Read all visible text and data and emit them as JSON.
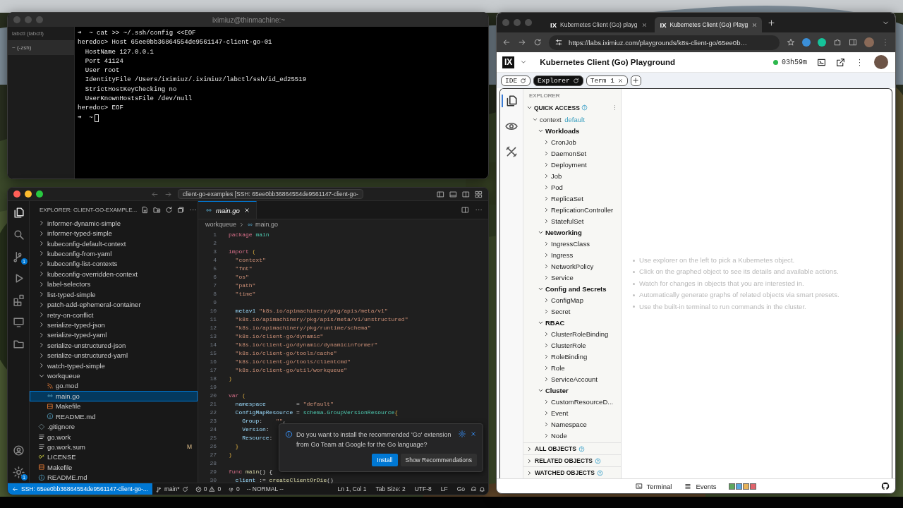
{
  "terminal": {
    "title": "iximiuz@thinmachine:~",
    "sessions": [
      {
        "label": "labctl (labctl)",
        "selected": false
      },
      {
        "label": "~ (-zsh)",
        "selected": true
      }
    ],
    "lines": [
      "➜  ~ cat >> ~/.ssh/config <<EOF",
      "heredoc> Host 65ee0bb36864554de9561147-client-go-01",
      "  HostName 127.0.0.1",
      "  Port 41124",
      "  User root",
      "  IdentityFile /Users/iximiuz/.iximiuz/labctl/ssh/id_ed25519",
      "  StrictHostKeyChecking no",
      "  UserKnownHostsFile /dev/null",
      "heredoc> EOF"
    ],
    "prompt": "➜  ~"
  },
  "vscode": {
    "command_center": "client-go-examples [SSH: 65ee0bb36864554de9561147-client-go-",
    "activity_bar": [
      {
        "kind": "explorer",
        "selected": true
      },
      {
        "kind": "search",
        "selected": false
      },
      {
        "kind": "scm",
        "selected": false,
        "badge": "1"
      },
      {
        "kind": "debug",
        "selected": false
      },
      {
        "kind": "extensions",
        "selected": false
      },
      {
        "kind": "remote",
        "selected": false
      },
      {
        "kind": "folder",
        "selected": false
      }
    ],
    "activity_bottom": [
      {
        "kind": "account",
        "selected": false
      },
      {
        "kind": "settings",
        "selected": false,
        "badge": "1"
      }
    ],
    "explorer_title": "EXPLORER: CLIENT-GO-EXAMPLE...",
    "files": [
      {
        "name": "informer-dynamic-simple",
        "kind": "folder",
        "expanded": false,
        "selected": false
      },
      {
        "name": "informer-typed-simple",
        "kind": "folder",
        "expanded": false,
        "selected": false
      },
      {
        "name": "kubeconfig-default-context",
        "kind": "folder",
        "expanded": false,
        "selected": false
      },
      {
        "name": "kubeconfig-from-yaml",
        "kind": "folder",
        "expanded": false,
        "selected": false
      },
      {
        "name": "kubeconfig-list-contexts",
        "kind": "folder",
        "expanded": false,
        "selected": false
      },
      {
        "name": "kubeconfig-overridden-context",
        "kind": "folder",
        "expanded": false,
        "selected": false
      },
      {
        "name": "label-selectors",
        "kind": "folder",
        "expanded": false,
        "selected": false
      },
      {
        "name": "list-typed-simple",
        "kind": "folder",
        "expanded": false,
        "selected": false
      },
      {
        "name": "patch-add-ephemeral-container",
        "kind": "folder",
        "expanded": false,
        "selected": false
      },
      {
        "name": "retry-on-conflict",
        "kind": "folder",
        "expanded": false,
        "selected": false
      },
      {
        "name": "serialize-typed-json",
        "kind": "folder",
        "expanded": false,
        "selected": false
      },
      {
        "name": "serialize-typed-yaml",
        "kind": "folder",
        "expanded": false,
        "selected": false
      },
      {
        "name": "serialize-unstructured-json",
        "kind": "folder",
        "expanded": false,
        "selected": false
      },
      {
        "name": "serialize-unstructured-yaml",
        "kind": "folder",
        "expanded": false,
        "selected": false
      },
      {
        "name": "watch-typed-simple",
        "kind": "folder",
        "expanded": false,
        "selected": false
      },
      {
        "name": "workqueue",
        "kind": "folder",
        "expanded": true,
        "selected": false,
        "children": [
          {
            "name": "go.mod",
            "kind": "gomod",
            "selected": false
          },
          {
            "name": "main.go",
            "kind": "go",
            "selected": true
          },
          {
            "name": "Makefile",
            "kind": "make",
            "selected": false
          },
          {
            "name": "README.md",
            "kind": "readme",
            "selected": false
          }
        ]
      },
      {
        "name": ".gitignore",
        "kind": "git",
        "selected": false
      },
      {
        "name": "go.work",
        "kind": "text",
        "selected": false
      },
      {
        "name": "go.work.sum",
        "kind": "text",
        "selected": false,
        "badge": "M"
      },
      {
        "name": "LICENSE",
        "kind": "license",
        "selected": false
      },
      {
        "name": "Makefile",
        "kind": "make",
        "selected": false
      },
      {
        "name": "README.md",
        "kind": "readme",
        "selected": false
      }
    ],
    "tab": {
      "label": "main.go"
    },
    "breadcrumb": [
      "workqueue",
      "main.go"
    ],
    "code": [
      {
        "number": "1",
        "tokens": [
          {
            "kind": "kw",
            "text": "package "
          },
          {
            "kind": "type",
            "text": "main"
          }
        ]
      },
      {
        "number": "2"
      },
      {
        "number": "3",
        "tokens": [
          {
            "kind": "kw",
            "text": "import "
          },
          {
            "kind": "punc",
            "text": "("
          }
        ]
      },
      {
        "number": "4",
        "tokens": [
          {
            "kind": "str",
            "text": "  \"context\""
          }
        ]
      },
      {
        "number": "5",
        "tokens": [
          {
            "kind": "str",
            "text": "  \"fmt\""
          }
        ]
      },
      {
        "number": "6",
        "tokens": [
          {
            "kind": "str",
            "text": "  \"os\""
          }
        ]
      },
      {
        "number": "7",
        "tokens": [
          {
            "kind": "str",
            "text": "  \"path\""
          }
        ]
      },
      {
        "number": "8",
        "tokens": [
          {
            "kind": "str",
            "text": "  \"time\""
          }
        ]
      },
      {
        "number": "9"
      },
      {
        "number": "10",
        "tokens": [
          {
            "kind": "var",
            "text": "  metav1 "
          },
          {
            "kind": "str",
            "text": "\"k8s.io/apimachinery/pkg/apis/meta/v1\""
          }
        ]
      },
      {
        "number": "11",
        "tokens": [
          {
            "kind": "str",
            "text": "  \"k8s.io/apimachinery/pkg/apis/meta/v1/unstructured\""
          }
        ]
      },
      {
        "number": "12",
        "tokens": [
          {
            "kind": "str",
            "text": "  \"k8s.io/apimachinery/pkg/runtime/schema\""
          }
        ]
      },
      {
        "number": "13",
        "tokens": [
          {
            "kind": "str",
            "text": "  \"k8s.io/client-go/dynamic\""
          }
        ]
      },
      {
        "number": "14",
        "tokens": [
          {
            "kind": "str",
            "text": "  \"k8s.io/client-go/dynamic/dynamicinformer\""
          }
        ]
      },
      {
        "number": "15",
        "tokens": [
          {
            "kind": "str",
            "text": "  \"k8s.io/client-go/tools/cache\""
          }
        ]
      },
      {
        "number": "16",
        "tokens": [
          {
            "kind": "str",
            "text": "  \"k8s.io/client-go/tools/clientcmd\""
          }
        ]
      },
      {
        "number": "17",
        "tokens": [
          {
            "kind": "str",
            "text": "  \"k8s.io/client-go/util/workqueue\""
          }
        ]
      },
      {
        "number": "18",
        "tokens": [
          {
            "kind": "punc",
            "text": ")"
          }
        ]
      },
      {
        "number": "19"
      },
      {
        "number": "20",
        "tokens": [
          {
            "kind": "kw",
            "text": "var "
          },
          {
            "kind": "punc",
            "text": "("
          }
        ]
      },
      {
        "number": "21",
        "tokens": [
          {
            "kind": "var",
            "text": "  namespace"
          },
          {
            "kind": "plain",
            "text": "         = "
          },
          {
            "kind": "str",
            "text": "\"default\""
          }
        ]
      },
      {
        "number": "22",
        "tokens": [
          {
            "kind": "var",
            "text": "  ConfigMapResource"
          },
          {
            "kind": "plain",
            "text": " = "
          },
          {
            "kind": "type",
            "text": "schema"
          },
          {
            "kind": "plain",
            "text": "."
          },
          {
            "kind": "type",
            "text": "GroupVersionResource"
          },
          {
            "kind": "punc",
            "text": "{"
          }
        ]
      },
      {
        "number": "23",
        "tokens": [
          {
            "kind": "var",
            "text": "    Group"
          },
          {
            "kind": "plain",
            "text": ":    "
          },
          {
            "kind": "str",
            "text": "\"\""
          },
          {
            "kind": "plain",
            "text": ","
          }
        ]
      },
      {
        "number": "24",
        "tokens": [
          {
            "kind": "var",
            "text": "    Version"
          },
          {
            "kind": "plain",
            "text": ":"
          }
        ]
      },
      {
        "number": "25",
        "tokens": [
          {
            "kind": "var",
            "text": "    Resource"
          },
          {
            "kind": "plain",
            "text": ":"
          }
        ]
      },
      {
        "number": "26",
        "tokens": [
          {
            "kind": "punc",
            "text": "  }"
          }
        ]
      },
      {
        "number": "27",
        "tokens": [
          {
            "kind": "punc",
            "text": ")"
          }
        ]
      },
      {
        "number": "28"
      },
      {
        "number": "29",
        "tokens": [
          {
            "kind": "kw",
            "text": "func "
          },
          {
            "kind": "fn",
            "text": "main"
          },
          {
            "kind": "plain",
            "text": "() {"
          }
        ]
      },
      {
        "number": "30",
        "tokens": [
          {
            "kind": "var",
            "text": "  client"
          },
          {
            "kind": "plain",
            "text": " := "
          },
          {
            "kind": "fn",
            "text": "createClientOrDie"
          },
          {
            "kind": "plain",
            "text": "()"
          }
        ]
      }
    ],
    "notification": {
      "message": "Do you want to install the recommended 'Go' extension from Go Team at Google for the Go language?",
      "buttons": [
        {
          "label": "Install",
          "kind": "primary"
        },
        {
          "label": "Show Recommendations",
          "kind": "secondary"
        }
      ]
    },
    "status_bar": {
      "remote": "SSH: 65ee0bb36864554de9561147-client-go-...",
      "branch": "main*",
      "errors": "0",
      "warnings": "0",
      "ports": "0",
      "mode": "-- NORMAL --",
      "items": [
        "Ln 1, Col 1",
        "Tab Size: 2",
        "UTF-8",
        "LF",
        "Go"
      ]
    }
  },
  "browser": {
    "tabs": [
      {
        "logo": "IX",
        "title": "Kubernetes Client (Go) playg",
        "selected": false
      },
      {
        "logo": "IX",
        "title": "Kubernetes Client (Go) Playg",
        "selected": true
      }
    ],
    "url": "https://labs.iximiuz.com/playgrounds/k8s-client-go/65ee0b…",
    "page": {
      "logo": "IX",
      "title": "Kubernetes Client (Go) Playground",
      "timer": "03h59m",
      "tabs": [
        {
          "label": "IDE",
          "kind": "view",
          "selected": false
        },
        {
          "label": "Explorer",
          "kind": "view",
          "selected": true
        },
        {
          "label": "Term 1",
          "kind": "terminal",
          "selected": false
        }
      ],
      "rail": [
        {
          "kind": "files",
          "selected": true
        },
        {
          "kind": "watch",
          "selected": false
        },
        {
          "kind": "tools",
          "selected": false
        }
      ],
      "explorer": {
        "heading": "EXPLORER",
        "quick_access": "QUICK ACCESS",
        "tree": [
          {
            "label": "context",
            "value": "default",
            "kind": "context",
            "expanded": true,
            "children": [
              {
                "label": "Workloads",
                "kind": "group",
                "expanded": true,
                "children": [
                  {
                    "label": "CronJob",
                    "kind": "resource",
                    "expanded": false
                  },
                  {
                    "label": "DaemonSet",
                    "kind": "resource",
                    "expanded": false
                  },
                  {
                    "label": "Deployment",
                    "kind": "resource",
                    "expanded": false
                  },
                  {
                    "label": "Job",
                    "kind": "resource",
                    "expanded": false
                  },
                  {
                    "label": "Pod",
                    "kind": "resource",
                    "expanded": false
                  },
                  {
                    "label": "ReplicaSet",
                    "kind": "resource",
                    "expanded": false
                  },
                  {
                    "label": "ReplicationController",
                    "kind": "resource",
                    "expanded": false
                  },
                  {
                    "label": "StatefulSet",
                    "kind": "resource",
                    "expanded": false
                  }
                ]
              },
              {
                "label": "Networking",
                "kind": "group",
                "expanded": true,
                "children": [
                  {
                    "label": "IngressClass",
                    "kind": "resource",
                    "expanded": false
                  },
                  {
                    "label": "Ingress",
                    "kind": "resource",
                    "expanded": false
                  },
                  {
                    "label": "NetworkPolicy",
                    "kind": "resource",
                    "expanded": false
                  },
                  {
                    "label": "Service",
                    "kind": "resource",
                    "expanded": false
                  }
                ]
              },
              {
                "label": "Config and Secrets",
                "kind": "group",
                "expanded": true,
                "children": [
                  {
                    "label": "ConfigMap",
                    "kind": "resource",
                    "expanded": false
                  },
                  {
                    "label": "Secret",
                    "kind": "resource",
                    "expanded": false
                  }
                ]
              },
              {
                "label": "RBAC",
                "kind": "group",
                "expanded": true,
                "children": [
                  {
                    "label": "ClusterRoleBinding",
                    "kind": "resource",
                    "expanded": false
                  },
                  {
                    "label": "ClusterRole",
                    "kind": "resource",
                    "expanded": false
                  },
                  {
                    "label": "RoleBinding",
                    "kind": "resource",
                    "expanded": false
                  },
                  {
                    "label": "Role",
                    "kind": "resource",
                    "expanded": false
                  },
                  {
                    "label": "ServiceAccount",
                    "kind": "resource",
                    "expanded": false
                  }
                ]
              },
              {
                "label": "Cluster",
                "kind": "group",
                "expanded": true,
                "children": [
                  {
                    "label": "CustomResourceD...",
                    "kind": "resource",
                    "expanded": false
                  },
                  {
                    "label": "Event",
                    "kind": "resource",
                    "expanded": false
                  },
                  {
                    "label": "Namespace",
                    "kind": "resource",
                    "expanded": false
                  },
                  {
                    "label": "Node",
                    "kind": "resource",
                    "expanded": false
                  }
                ]
              }
            ]
          }
        ],
        "sections": [
          {
            "label": "ALL OBJECTS",
            "expanded": false
          },
          {
            "label": "RELATED OBJECTS",
            "expanded": false
          },
          {
            "label": "WATCHED OBJECTS",
            "expanded": false
          }
        ]
      },
      "hints": [
        "Use explorer on the left to pick a Kubernetes object.",
        "Click on the graphed object to see its details and available actions.",
        "Watch for changes in objects that you are interested in.",
        "Automatically generate graphs of related objects via smart presets.",
        "Use the built-in terminal to run commands in the cluster."
      ],
      "footer": {
        "items": [
          {
            "label": "Terminal",
            "kind": "terminal"
          },
          {
            "label": "Events",
            "kind": "events"
          }
        ],
        "swatches": [
          {
            "color": "#5ea65e"
          },
          {
            "color": "#5aa6e0"
          },
          {
            "color": "#e6b25a"
          },
          {
            "color": "#e0646c"
          }
        ]
      }
    }
  }
}
